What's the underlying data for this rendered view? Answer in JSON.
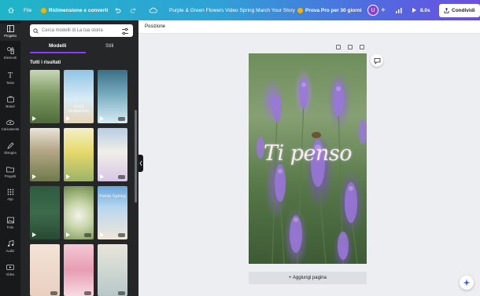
{
  "topbar": {
    "file_label": "File",
    "resize_label": "Ridimensione e converti",
    "doc_title": "Purple & Green Flowers Video Spring March Your Story",
    "trial_label": "Prova Pro per 30 giorni",
    "avatar_initial": "U",
    "duration": "8.0s",
    "share_label": "Condividi"
  },
  "rail": {
    "items": [
      {
        "label": "Progetto",
        "icon": "layout-icon"
      },
      {
        "label": "Elementi",
        "icon": "shapes-icon"
      },
      {
        "label": "Testo",
        "icon": "text-icon"
      },
      {
        "label": "Brand",
        "icon": "brand-icon"
      },
      {
        "label": "Caricamenti",
        "icon": "upload-icon"
      },
      {
        "label": "Disegna",
        "icon": "pen-icon"
      },
      {
        "label": "Progetti",
        "icon": "folder-icon"
      },
      {
        "label": "App",
        "icon": "apps-icon"
      },
      {
        "label": "Foto",
        "icon": "photo-icon"
      },
      {
        "label": "Audio",
        "icon": "music-icon"
      },
      {
        "label": "Video",
        "icon": "video-icon"
      }
    ]
  },
  "panel": {
    "search_placeholder": "Cerca modelli di La tua storia",
    "tabs": [
      "Modelli",
      "Stili"
    ],
    "section_title": "Tutti i risultati",
    "thumb_captions": [
      "",
      "Good MORNING",
      "",
      "",
      "",
      "",
      "",
      "Fields Spring",
      "",
      "",
      "",
      ""
    ]
  },
  "canvas": {
    "position_label": "Posizione",
    "page_text": "Ti penso",
    "add_page_label": "+ Aggiungi pagina"
  },
  "colors": {
    "accent": "#8b3dff",
    "topbar_start": "#1fb5c8",
    "topbar_end": "#6b4ee0",
    "panel_bg": "#252627"
  }
}
